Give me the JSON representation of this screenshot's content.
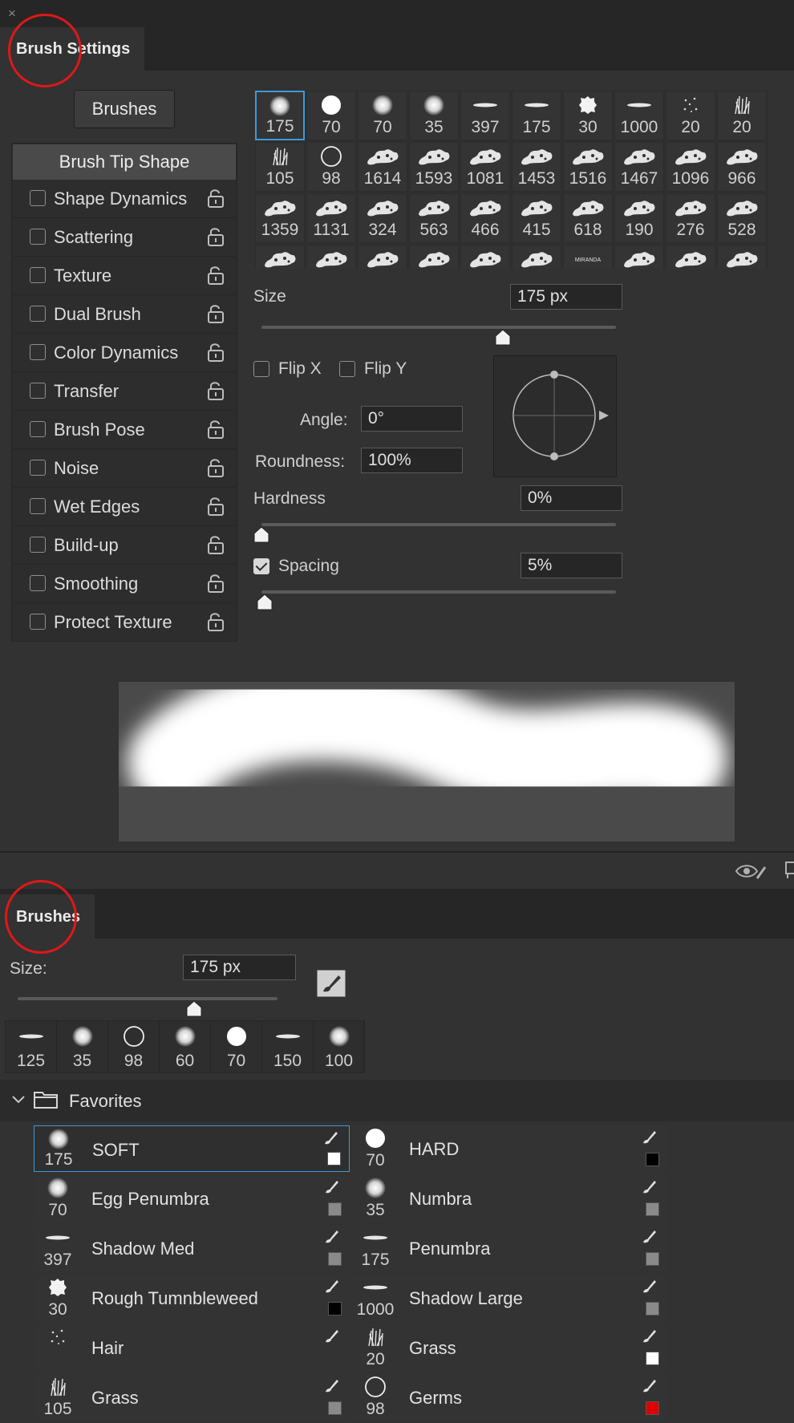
{
  "window": {
    "close_glyph": "×"
  },
  "brush_settings": {
    "tab_title": "Brush Settings",
    "brushes_button": "Brushes",
    "list_header": "Brush Tip Shape",
    "options": [
      {
        "label": "Shape Dynamics",
        "checked": false
      },
      {
        "label": "Scattering",
        "checked": false
      },
      {
        "label": "Texture",
        "checked": false
      },
      {
        "label": "Dual Brush",
        "checked": false
      },
      {
        "label": "Color Dynamics",
        "checked": false
      },
      {
        "label": "Transfer",
        "checked": false
      },
      {
        "label": "Brush Pose",
        "checked": false
      },
      {
        "label": "Noise",
        "checked": false
      },
      {
        "label": "Wet Edges",
        "checked": false
      },
      {
        "label": "Build-up",
        "checked": false
      },
      {
        "label": "Smoothing",
        "checked": false
      },
      {
        "label": "Protect Texture",
        "checked": false
      }
    ],
    "tip_grid": [
      {
        "size": "175",
        "icon": "soft-round-brush-icon"
      },
      {
        "size": "70",
        "icon": "hard-round-brush-icon"
      },
      {
        "size": "70",
        "icon": "soft-round-brush-icon"
      },
      {
        "size": "35",
        "icon": "soft-round-brush-icon"
      },
      {
        "size": "397",
        "icon": "flat-brush-icon"
      },
      {
        "size": "175",
        "icon": "flat-brush-icon"
      },
      {
        "size": "30",
        "icon": "rough-brush-icon"
      },
      {
        "size": "1000",
        "icon": "flat-brush-icon"
      },
      {
        "size": "20",
        "icon": "dots-brush-icon"
      },
      {
        "size": "20",
        "icon": "grass-brush-icon"
      },
      {
        "size": "105",
        "icon": "grass-brush-icon"
      },
      {
        "size": "98",
        "icon": "ring-brush-icon"
      },
      {
        "size": "1614",
        "icon": "cloud-brush-icon"
      },
      {
        "size": "1593",
        "icon": "cloud-brush-icon"
      },
      {
        "size": "1081",
        "icon": "cloud-brush-icon"
      },
      {
        "size": "1453",
        "icon": "cloud-brush-icon"
      },
      {
        "size": "1516",
        "icon": "cloud-brush-icon"
      },
      {
        "size": "1467",
        "icon": "cloud-brush-icon"
      },
      {
        "size": "1096",
        "icon": "cloud-brush-icon"
      },
      {
        "size": "966",
        "icon": "cloud-brush-icon"
      },
      {
        "size": "1359",
        "icon": "cloud-brush-icon"
      },
      {
        "size": "1131",
        "icon": "cloud-brush-icon"
      },
      {
        "size": "324",
        "icon": "cloud-brush-icon"
      },
      {
        "size": "563",
        "icon": "cloud-brush-icon"
      },
      {
        "size": "466",
        "icon": "cloud-brush-icon"
      },
      {
        "size": "415",
        "icon": "cloud-brush-icon"
      },
      {
        "size": "618",
        "icon": "cloud-brush-icon"
      },
      {
        "size": "190",
        "icon": "cloud-brush-icon"
      },
      {
        "size": "276",
        "icon": "cloud-brush-icon"
      },
      {
        "size": "528",
        "icon": "cloud-brush-icon"
      },
      {
        "size": "",
        "icon": "cloud-brush-icon"
      },
      {
        "size": "",
        "icon": "cloud-brush-icon"
      },
      {
        "size": "",
        "icon": "cloud-brush-icon"
      },
      {
        "size": "",
        "icon": "cloud-brush-icon"
      },
      {
        "size": "",
        "icon": "cloud-brush-icon"
      },
      {
        "size": "",
        "icon": "cloud-brush-icon"
      },
      {
        "size": "M)",
        "icon": "logo-brush-icon"
      },
      {
        "size": "",
        "icon": "cloud-brush-icon"
      },
      {
        "size": "",
        "icon": "cloud-brush-icon"
      },
      {
        "size": "",
        "icon": "cloud-brush-icon"
      }
    ],
    "size_label": "Size",
    "size_value": "175 px",
    "size_slider_fraction": 0.68,
    "flip_x_label": "Flip X",
    "flip_y_label": "Flip Y",
    "angle_label": "Angle:",
    "angle_value": "0°",
    "roundness_label": "Roundness:",
    "roundness_value": "100%",
    "hardness_label": "Hardness",
    "hardness_value": "0%",
    "hardness_slider_fraction": 0.0,
    "spacing_label": "Spacing",
    "spacing_checked": true,
    "spacing_value": "5%",
    "spacing_slider_fraction": 0.01
  },
  "brushes_panel": {
    "tab_title": "Brushes",
    "size_label": "Size:",
    "size_value": "175 px",
    "size_slider_fraction": 0.68,
    "presets": [
      {
        "size": "125",
        "icon": "flat-brush-icon"
      },
      {
        "size": "35",
        "icon": "soft-round-brush-icon"
      },
      {
        "size": "98",
        "icon": "ring-brush-icon"
      },
      {
        "size": "60",
        "icon": "soft-round-brush-icon"
      },
      {
        "size": "70",
        "icon": "hard-round-brush-icon"
      },
      {
        "size": "150",
        "icon": "flat-brush-icon"
      },
      {
        "size": "100",
        "icon": "soft-round-brush-icon"
      }
    ],
    "folder_name": "Favorites",
    "items": [
      {
        "name": "SOFT",
        "size": "175",
        "icon": "soft-round-brush-icon",
        "color": "#ffffff"
      },
      {
        "name": "HARD",
        "size": "70",
        "icon": "hard-round-brush-icon",
        "color": "#000000"
      },
      {
        "name": "Egg Penumbra",
        "size": "70",
        "icon": "soft-round-brush-icon",
        "color": "#8a8a8a"
      },
      {
        "name": "Numbra",
        "size": "35",
        "icon": "soft-round-brush-icon",
        "color": "#8a8a8a"
      },
      {
        "name": "Shadow Med",
        "size": "397",
        "icon": "flat-brush-icon",
        "color": "#8a8a8a"
      },
      {
        "name": "Penumbra",
        "size": "175",
        "icon": "flat-brush-icon",
        "color": "#8a8a8a"
      },
      {
        "name": "Rough Tumnbleweed",
        "size": "30",
        "icon": "rough-brush-icon",
        "color": "#000000"
      },
      {
        "name": "Shadow Large",
        "size": "1000",
        "icon": "flat-brush-icon",
        "color": "#8a8a8a"
      },
      {
        "name": "Hair",
        "size": "",
        "icon": "dots-brush-icon",
        "color": ""
      },
      {
        "name": "Grass",
        "size": "20",
        "icon": "grass-brush-icon",
        "color": "#ffffff"
      },
      {
        "name": "Grass",
        "size": "105",
        "icon": "grass-brush-icon",
        "color": "#8a8a8a"
      },
      {
        "name": "Germs",
        "size": "98",
        "icon": "ring-brush-icon",
        "color": "#e00000"
      }
    ]
  },
  "accent_color": "#3a9ad9",
  "annotation_color": "#e01818"
}
